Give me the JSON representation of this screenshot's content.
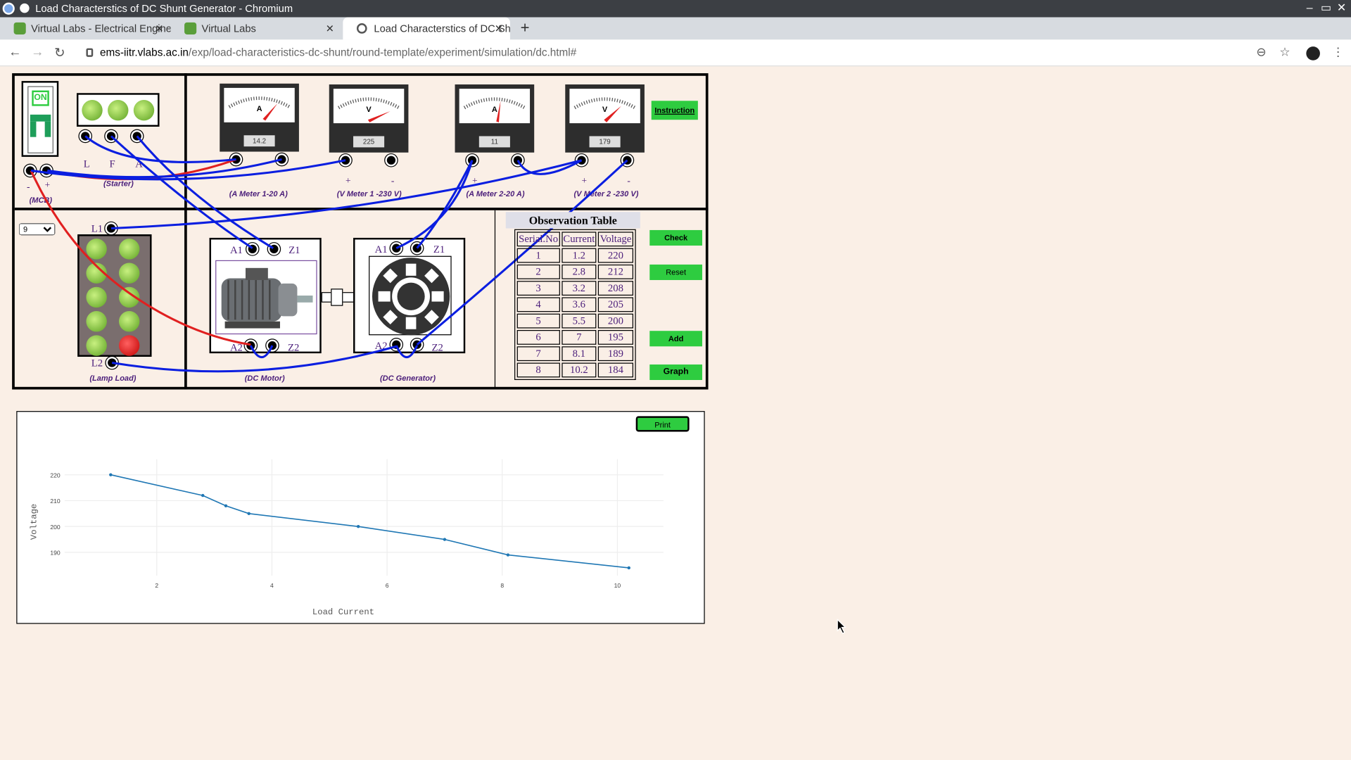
{
  "window": {
    "title": "Load Characterstics of DC Shunt Generator - Chromium"
  },
  "tabs": [
    {
      "label": "Virtual Labs - Electrical Engine"
    },
    {
      "label": "Virtual Labs"
    },
    {
      "label": "Load Characterstics of DC Sh"
    }
  ],
  "address": {
    "host": "ems-iitr.vlabs.ac.in",
    "path": "/exp/load-characteristics-dc-shunt/round-template/experiment/simulation/dc.html#"
  },
  "sim": {
    "mcb": {
      "switch_label": "ON",
      "caption": "(MCB)",
      "minus": "-",
      "plus": "+"
    },
    "starter": {
      "caption": "(Starter)",
      "l": "L",
      "f": "F",
      "a": "A"
    },
    "meters": [
      {
        "letter": "A",
        "reading": "14.2",
        "caption": "(A Meter 1-20 A)"
      },
      {
        "letter": "V",
        "reading": "225",
        "caption": "(V Meter 1 -230 V)"
      },
      {
        "letter": "A",
        "reading": "11",
        "caption": "(A Meter 2-20 A)"
      },
      {
        "letter": "V",
        "reading": "179",
        "caption": "(V Meter 2 -230 V)"
      }
    ],
    "instruction_label": "Instruction",
    "lamp_select": "9",
    "lamp": {
      "l1": "L1",
      "l2": "L2",
      "caption": "(Lamp Load)"
    },
    "motor": {
      "a1": "A1",
      "z1": "Z1",
      "a2": "A2",
      "z2": "Z2",
      "caption": "(DC Motor)"
    },
    "generator": {
      "a1": "A1",
      "z1": "Z1",
      "a2": "A2",
      "z2": "Z2",
      "caption": "(DC Generator)"
    },
    "obs": {
      "title": "Observation Table",
      "headers": [
        "Serial.No",
        "Current",
        "Voltage"
      ],
      "rows": [
        [
          "1",
          "1.2",
          "220"
        ],
        [
          "2",
          "2.8",
          "212"
        ],
        [
          "3",
          "3.2",
          "208"
        ],
        [
          "4",
          "3.6",
          "205"
        ],
        [
          "5",
          "5.5",
          "200"
        ],
        [
          "6",
          "7",
          "195"
        ],
        [
          "7",
          "8.1",
          "189"
        ],
        [
          "8",
          "10.2",
          "184"
        ]
      ]
    },
    "buttons": {
      "check": "Check",
      "reset": "Reset",
      "add": "Add",
      "graph": "Graph"
    }
  },
  "print_label": "Print",
  "chart_data": {
    "type": "line",
    "xlabel": "Load Current",
    "ylabel": "Voltage",
    "x": [
      1.2,
      2.8,
      3.2,
      3.6,
      5.5,
      7,
      8.1,
      10.2
    ],
    "y": [
      220,
      212,
      208,
      205,
      200,
      195,
      189,
      184
    ],
    "xticks": [
      2,
      4,
      6,
      8,
      10
    ],
    "yticks": [
      190,
      200,
      210,
      220
    ],
    "xlim": [
      0.4,
      10.8
    ],
    "ylim": [
      181,
      226
    ],
    "color": "#1f77b4",
    "grid": true
  }
}
